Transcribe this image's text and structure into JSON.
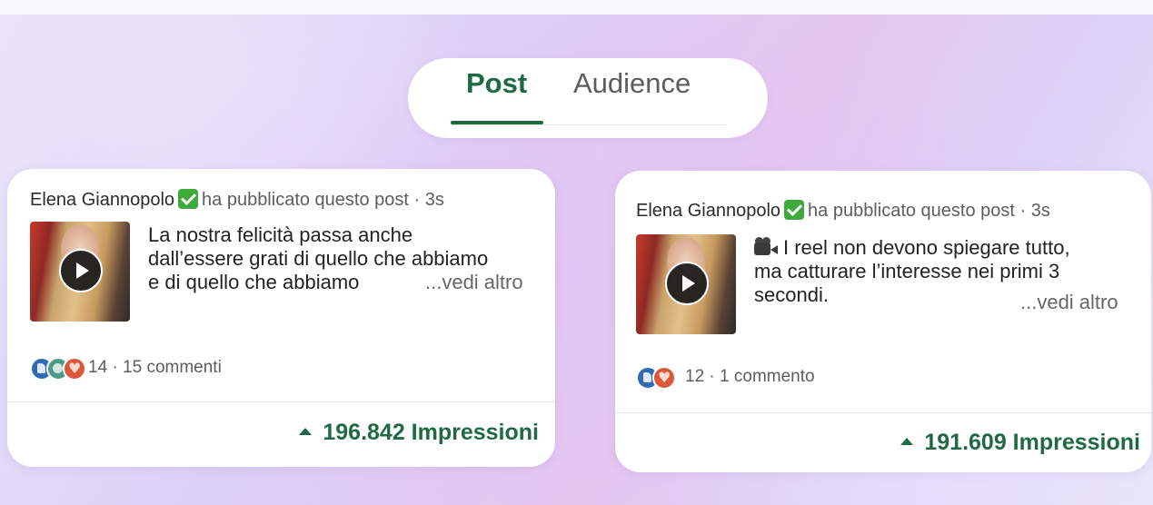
{
  "tabs": {
    "post": "Post",
    "audience": "Audience",
    "active": "Post"
  },
  "colors": {
    "accent": "#1f6a43",
    "verified": "#3faa3c"
  },
  "posts": [
    {
      "author": "Elena Giannopolo",
      "verified_icon": "verified-check-icon",
      "action": "ha pubblicato questo post",
      "time": "3s",
      "text_lines": [
        "La nostra felicità passa anche",
        "dall’essere grati di quello che abbiamo",
        "e di quello che abbiamo"
      ],
      "emoji_icon": "",
      "more": "...vedi altro",
      "reaction_icons": [
        "like-reaction-icon",
        "celebrate-reaction-icon",
        "love-reaction-icon"
      ],
      "reactions_count": "14",
      "comments": "15 commenti",
      "impressions": "196.842 Impressioni"
    },
    {
      "author": "Elena Giannopolo",
      "verified_icon": "verified-check-icon",
      "action": "ha pubblicato questo post",
      "time": "3s",
      "text_lines": [
        "I reel non devono spiegare tutto,",
        "ma catturare l’interesse nei primi 3",
        "secondi."
      ],
      "emoji_icon": "movie-camera-icon",
      "more": "...vedi altro",
      "reaction_icons": [
        "like-reaction-icon",
        "love-reaction-icon"
      ],
      "reactions_count": "12",
      "comments": "1 commento",
      "impressions": "191.609 Impressioni"
    }
  ]
}
